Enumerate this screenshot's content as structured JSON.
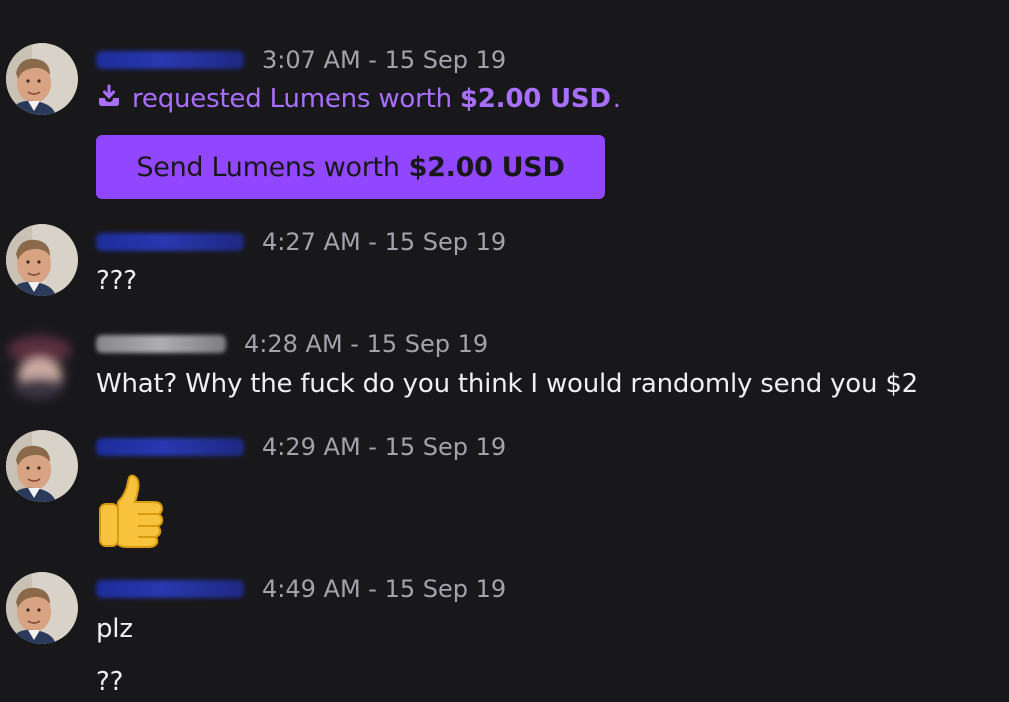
{
  "messages": [
    {
      "time": "3:07 AM - 15 Sep 19",
      "request_text": "requested Lumens worth",
      "request_amount": "$2.00 USD",
      "request_suffix": ".",
      "button_text": "Send Lumens worth",
      "button_amount": "$2.00 USD",
      "icon": "lumens-request-icon"
    },
    {
      "time": "4:27 AM - 15 Sep 19",
      "text": "???"
    },
    {
      "time": "4:28 AM - 15 Sep 19",
      "text": "What? Why the fuck do you think I would randomly send you $2"
    },
    {
      "time": "4:29 AM - 15 Sep 19",
      "emoji": "thumbs-up"
    },
    {
      "time": "4:49 AM - 15 Sep 19",
      "lines": [
        "plz",
        "??"
      ]
    }
  ],
  "colors": {
    "background": "#18181b",
    "accent": "#9147ff",
    "request_text": "#a970ff",
    "timestamp": "#a3a3ab"
  }
}
